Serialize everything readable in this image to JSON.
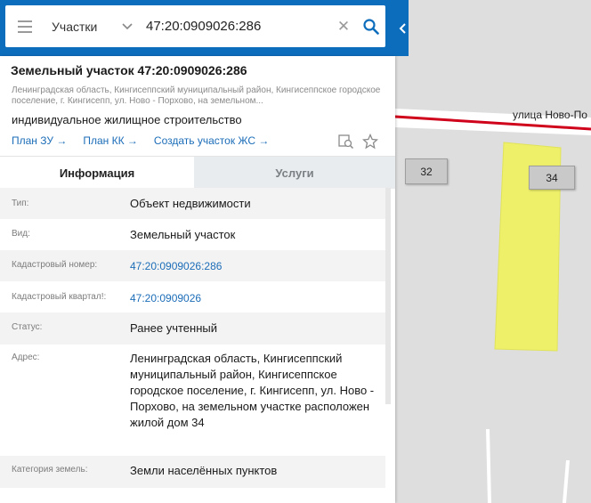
{
  "search": {
    "layer": "Участки",
    "query": "47:20:0909026:286"
  },
  "object": {
    "title": "Земельный участок 47:20:0909026:286",
    "address_short": "Ленинградская область, Кингисеппский муниципальный район, Кингисеппское городское поселение, г. Кингисепп, ул. Ново - Порхово, на земельном...",
    "use": "индивидуальное жилищное строительство"
  },
  "actions": {
    "plan_zu": "План ЗУ →",
    "plan_kk": "План КК →",
    "create_zs": "Создать участок ЖС →"
  },
  "tabs": {
    "info": "Информация",
    "services": "Услуги"
  },
  "properties": [
    {
      "key": "Тип:",
      "value": "Объект недвижимости"
    },
    {
      "key": "Вид:",
      "value": "Земельный участок"
    },
    {
      "key": "Кадастровый номер:",
      "value": "47:20:0909026:286"
    },
    {
      "key": "Кадастровый квартал!:",
      "value": "47:20:0909026"
    },
    {
      "key": "Статус:",
      "value": "Ранее учтенный"
    },
    {
      "key": "Адрес:",
      "value": "Ленинградская область, Кингисеппский муниципальный район, Кингисеппское городское поселение, г. Кингисепп, ул. Ново - Порхово, на земельном участке расположен жилой дом 34"
    },
    {
      "key": "Категория земель:",
      "value": "Земли населённых пунктов"
    }
  ],
  "map": {
    "street": "улица Ново-По",
    "house_32": "32",
    "house_34": "34"
  },
  "colors": {
    "topbar": "#0d6dbd",
    "parcel": "#eef06a",
    "road": "#d0021b",
    "link": "#1c6db8"
  }
}
